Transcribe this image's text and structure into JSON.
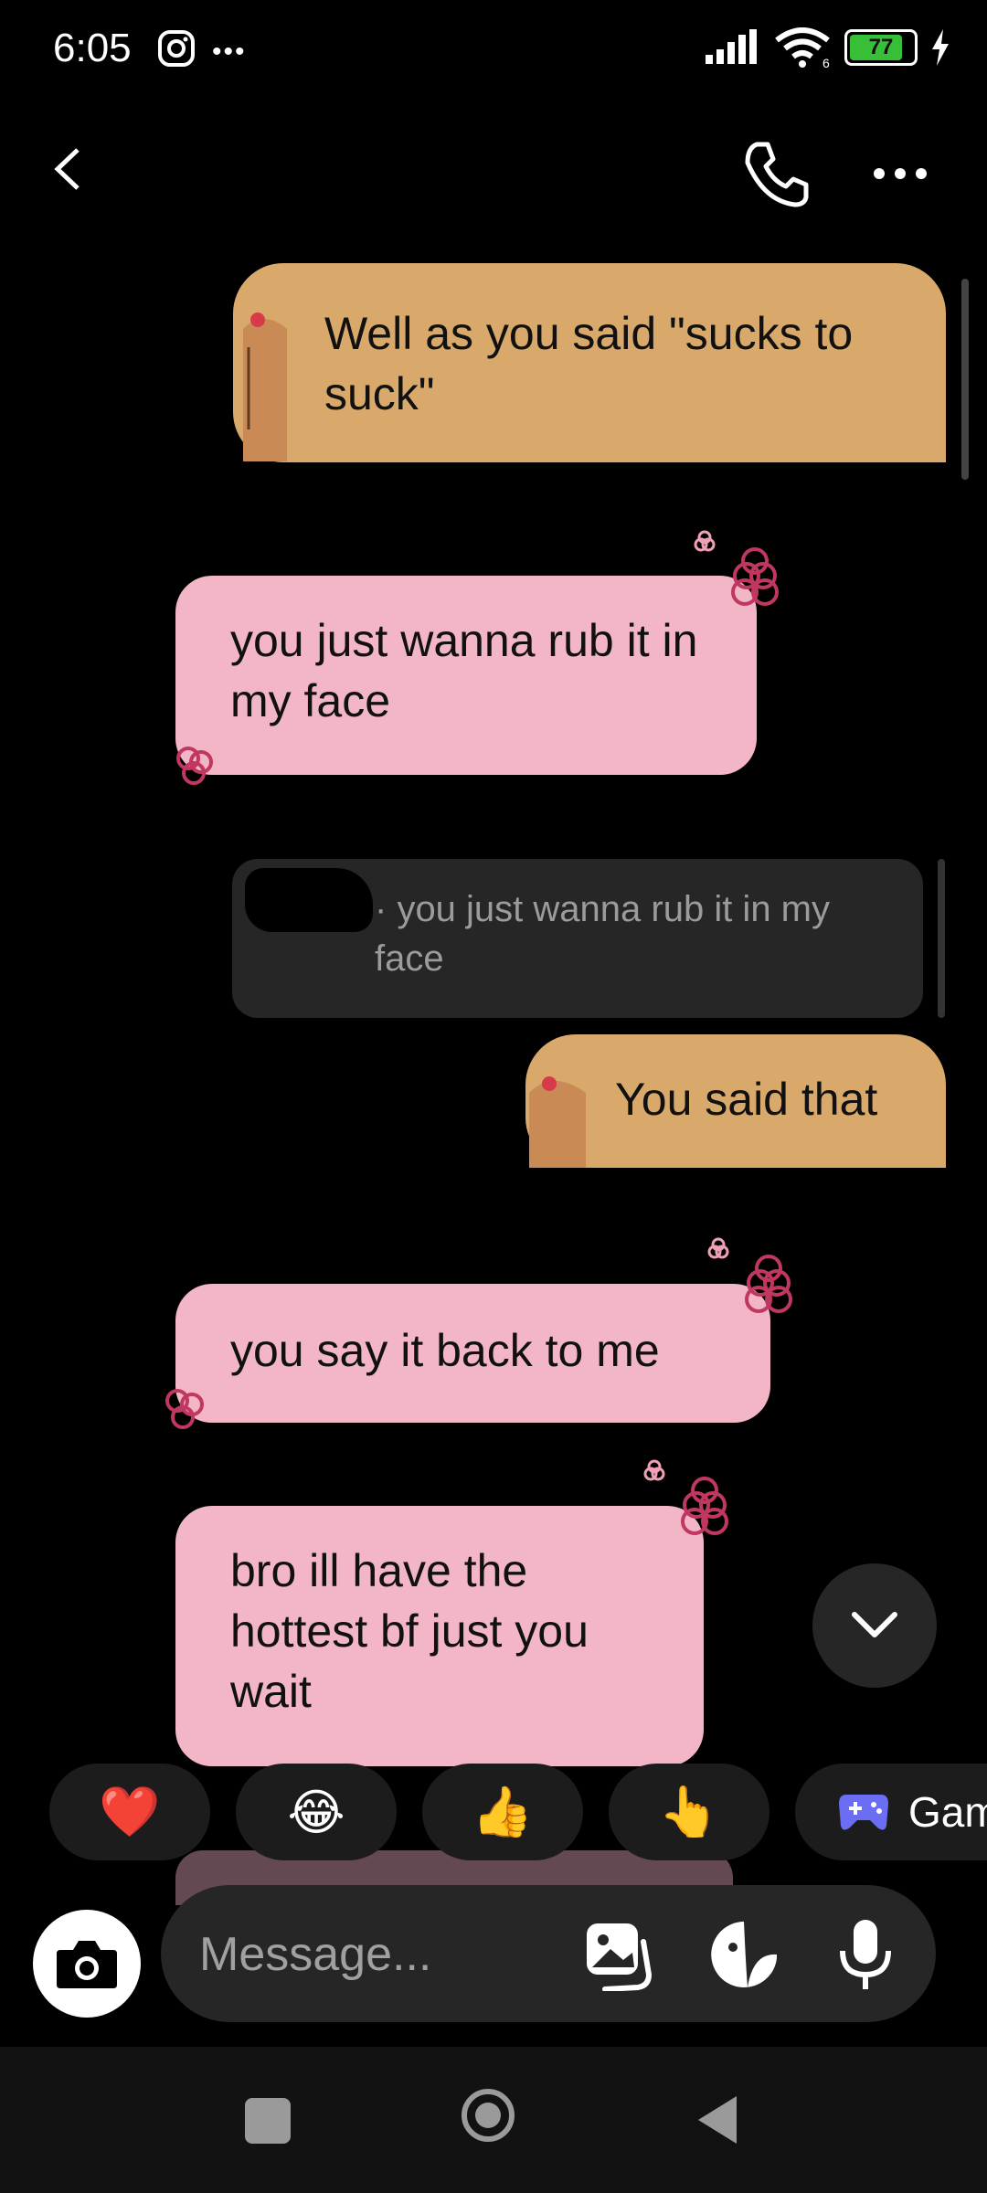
{
  "status_bar": {
    "time": "6:05",
    "battery": "77",
    "network": "6"
  },
  "messages": [
    {
      "id": "m1",
      "side": "sent",
      "text": "Well as you said \"sucks to suck\""
    },
    {
      "id": "m2",
      "side": "received",
      "text": "you just wanna rub it in my face"
    },
    {
      "id": "m3",
      "side": "sent",
      "type": "reply",
      "quoted_text": "you just wanna rub it in my face"
    },
    {
      "id": "m4",
      "side": "sent",
      "text": "You said that"
    },
    {
      "id": "m5",
      "side": "received",
      "text": "you say it back to me"
    },
    {
      "id": "m6",
      "side": "received",
      "text": "bro ill have the hottest bf just you wait"
    }
  ],
  "quick_reactions": [
    {
      "emoji": "❤️",
      "icon": "heart-emoji"
    },
    {
      "emoji": "😂",
      "icon": "laughing-emoji"
    },
    {
      "emoji": "👍",
      "icon": "thumbs-up-emoji"
    },
    {
      "emoji": "👆",
      "icon": "pointing-hand-emoji"
    }
  ],
  "games_label": "Gam",
  "composer": {
    "placeholder": "Message..."
  },
  "colors": {
    "sent_bubble": "#d9a96b",
    "received_bubble": "#f3b6c7",
    "accent_flower": "#c0375f",
    "battery": "#37c037"
  }
}
